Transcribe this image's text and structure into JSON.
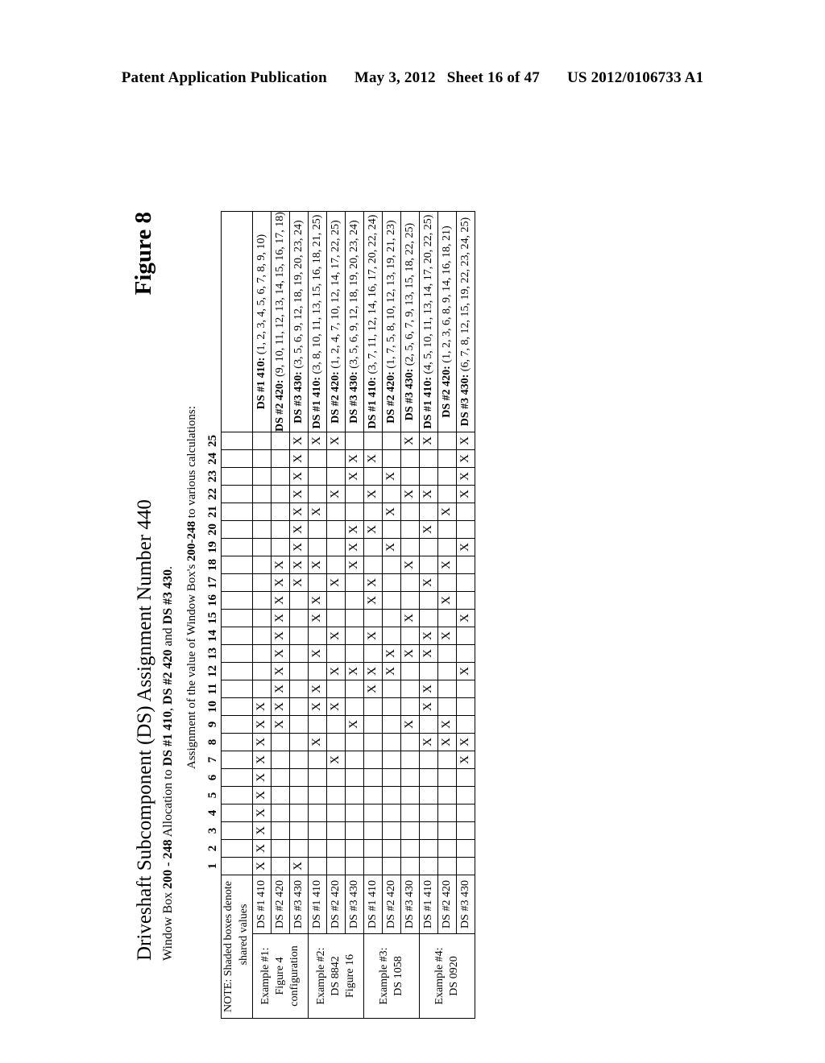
{
  "page_header": {
    "publication": "Patent Application Publication",
    "date": "May 3, 2012",
    "sheet": "Sheet 16 of 47",
    "doc_number": "US 2012/0106733 A1"
  },
  "figure": {
    "label": "Figure 8",
    "title": "Driveshaft Subcomponent (DS) Assignment Number 440",
    "subtitle": "Window Box 200 - 248 Allocation to DS #1 410, DS #2 420 and DS #3 430.",
    "assignment_caption": "Assignment of the value of Window Box's 200-248 to various calculations:",
    "note_line1": "NOTE:  Shaded boxes denote",
    "note_line2": "shared values"
  },
  "table": {
    "column_numbers": [
      1,
      2,
      3,
      4,
      5,
      6,
      7,
      8,
      9,
      10,
      11,
      12,
      13,
      14,
      15,
      16,
      17,
      18,
      19,
      20,
      21,
      22,
      23,
      24,
      25
    ],
    "examples": [
      {
        "label_lines": [
          "Example #1:",
          "Figure 4",
          "configuration"
        ],
        "rows": [
          {
            "ds_label": "DS #1 410",
            "set_label": "DS #1 410:",
            "set_values": "(1, 2, 3, 4, 5, 6, 7, 8, 9, 10)",
            "marks": [
              1,
              2,
              3,
              4,
              5,
              6,
              7,
              8,
              9,
              10
            ]
          },
          {
            "ds_label": "DS #2 420",
            "set_label": "DS #2 420:",
            "set_values": "(9, 10, 11, 12, 13, 14, 15, 16, 17, 18)",
            "marks": [
              9,
              10,
              11,
              12,
              13,
              14,
              15,
              16,
              17,
              18
            ]
          },
          {
            "ds_label": "DS #3 430",
            "set_label": "DS #3 430:",
            "set_values": "(3, 5, 6, 9, 12, 18, 19, 20, 23, 24)",
            "marks": [
              1,
              17,
              18,
              19,
              20,
              21,
              22,
              23,
              24,
              25
            ]
          }
        ]
      },
      {
        "label_lines": [
          "Example #2:",
          "DS 8842",
          "Figure 16"
        ],
        "rows": [
          {
            "ds_label": "DS #1 410",
            "set_label": "DS #1 410:",
            "set_values": "(3, 8, 10, 11, 13, 15, 16, 18, 21, 25)",
            "marks": [
              8,
              10,
              11,
              13,
              15,
              16,
              18,
              21,
              25
            ]
          },
          {
            "ds_label": "DS #2 420",
            "set_label": "DS #2 420:",
            "set_values": "(1, 2, 4, 7, 10, 12, 14, 17, 22, 25)",
            "marks": [
              7,
              10,
              12,
              14,
              17,
              22,
              25
            ]
          },
          {
            "ds_label": "DS #3 430",
            "set_label": "DS #3 430:",
            "set_values": "(3, 5, 6, 9, 12, 18, 19, 20, 23, 24)",
            "marks": [
              9,
              12,
              18,
              19,
              20,
              23,
              24
            ]
          }
        ]
      },
      {
        "label_lines": [
          "Example #3:",
          "DS 1058"
        ],
        "rows": [
          {
            "ds_label": "DS #1 410",
            "set_label": "DS #1 410:",
            "set_values": "(3, 7, 11, 12, 14, 16, 17, 20, 22, 24)",
            "marks": [
              11,
              12,
              14,
              16,
              17,
              20,
              22,
              24
            ]
          },
          {
            "ds_label": "DS #2 420",
            "set_label": "DS #2 420:",
            "set_values": "(1, 7, 5, 8, 10, 12, 13, 19, 21, 23)",
            "marks": [
              12,
              13,
              19,
              21,
              23
            ]
          },
          {
            "ds_label": "DS #3 430",
            "set_label": "DS #3 430:",
            "set_values": "(2, 5, 6, 7, 9, 13, 15, 18, 22, 25)",
            "marks": [
              9,
              13,
              15,
              18,
              22,
              25
            ]
          }
        ]
      },
      {
        "label_lines": [
          "Example #4:",
          "DS 0920"
        ],
        "rows": [
          {
            "ds_label": "DS #1 410",
            "set_label": "DS #1 410:",
            "set_values": "(4, 5, 10, 11, 13, 14, 17, 20, 22, 25)",
            "marks": [
              8,
              10,
              11,
              13,
              14,
              17,
              20,
              22,
              25
            ]
          },
          {
            "ds_label": "DS #2 420",
            "set_label": "DS #2 420:",
            "set_values": "(1, 2, 3, 6, 8, 9, 14, 16, 18, 21)",
            "marks": [
              8,
              9,
              14,
              16,
              18,
              21
            ]
          },
          {
            "ds_label": "DS #3 430",
            "set_label": "DS #3 430:",
            "set_values": "(6, 7, 8, 12, 15, 19, 22, 23, 24, 25)",
            "marks": [
              7,
              8,
              12,
              15,
              19,
              22,
              23,
              24,
              25
            ]
          }
        ]
      }
    ],
    "shaded_columns_by_row": [
      [],
      [],
      [],
      [],
      [],
      [],
      [],
      [],
      [],
      [],
      [],
      []
    ],
    "mark_glyph": "X"
  }
}
